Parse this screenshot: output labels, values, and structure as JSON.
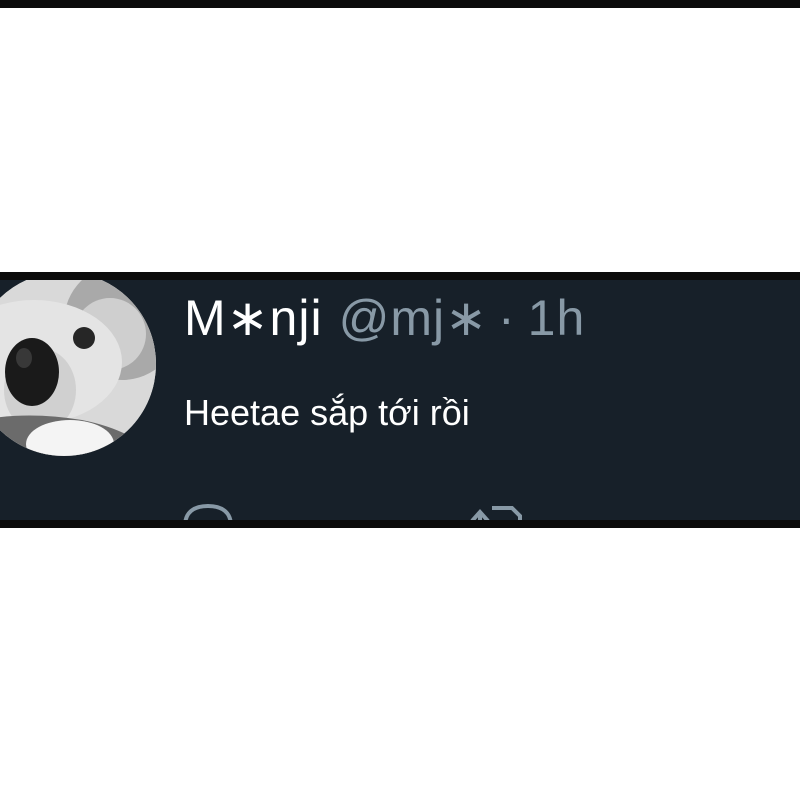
{
  "tweet": {
    "display_name": "M∗nji",
    "handle": "@mj∗",
    "separator": "·",
    "time": "1h",
    "text": "Heetae sắp tới rồi",
    "avatar": "koala-avatar",
    "actions": [
      {
        "icon": "reply-icon"
      },
      {
        "icon": "retweet-icon"
      }
    ]
  },
  "colors": {
    "page_background": "#ffffff",
    "frame_border": "#0b0b0b",
    "tweet_background": "#172029",
    "primary_text": "#ffffff",
    "secondary_text": "#8899a6"
  }
}
